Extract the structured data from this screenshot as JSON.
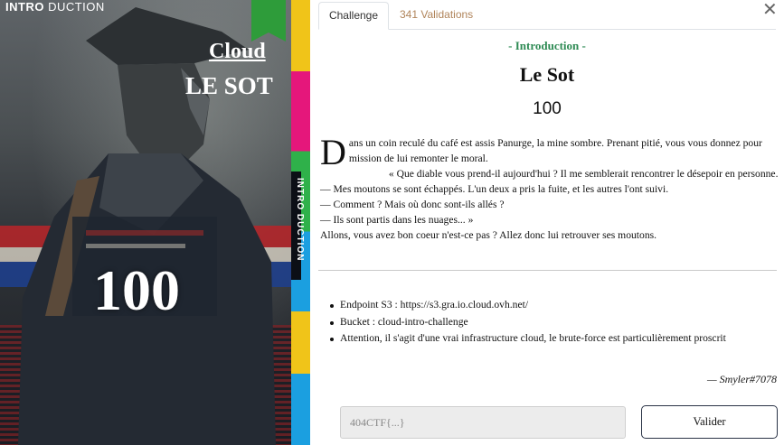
{
  "card": {
    "top_label_bold": "INTRO",
    "top_label_rest": "DUCTION",
    "category": "Cloud",
    "name": "LE SOT",
    "points": "100",
    "side_label": "INTRO DUCTION",
    "colors": {
      "ribbon": "#2e9c3a",
      "stripe_yellow": "#f0c419",
      "stripe_pink": "#e5177b",
      "stripe_green": "#2fb14a",
      "stripe_blue": "#1b9fe0"
    }
  },
  "tabs": [
    {
      "label": "Challenge",
      "active": true
    },
    {
      "label": "341 Validations",
      "active": false
    }
  ],
  "close_icon": "close-icon",
  "challenge": {
    "category": "- Introduction -",
    "title": "Le Sot",
    "points": "100",
    "dropcap": "D",
    "story": {
      "p1": "ans un coin reculé du café est assis Panurge, la mine sombre. Prenant pitié, vous vous donnez pour mission de lui remonter le moral.",
      "p2": "« Que diable vous prend-il aujourd'hui ? Il me semblerait rencontrer le désepoir en personne.",
      "p3": "— Mes moutons se sont échappés. L'un deux a pris la fuite, et les autres l'ont suivi.",
      "p4": "— Comment ? Mais où donc sont-ils allés ?",
      "p5": "— Ils sont partis dans les nuages... »",
      "p6": "Allons, vous avez bon coeur n'est-ce pas ? Allez donc lui retrouver ses moutons."
    },
    "info": [
      "Endpoint S3 : https://s3.gra.io.cloud.ovh.net/",
      "Bucket : cloud-intro-challenge",
      "Attention, il s'agit d'une vrai infrastructure cloud, le brute-force est particulièrement proscrit"
    ],
    "author": "— Smyler#7078"
  },
  "form": {
    "flag_placeholder": "404CTF{...}",
    "flag_value": "",
    "submit_label": "Valider"
  },
  "colors": {
    "accent_green": "#2d8a53",
    "tab_inactive": "#b0845a",
    "button_border": "#2a3346"
  }
}
